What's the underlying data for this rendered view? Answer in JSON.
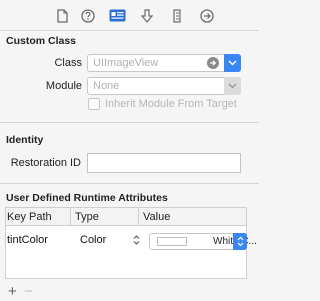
{
  "sections": {
    "custom_class": {
      "title": "Custom Class",
      "class_label": "Class",
      "class_value": "UIImageView",
      "module_label": "Module",
      "module_value": "None",
      "inherit_label": "Inherit Module From Target"
    },
    "identity": {
      "title": "Identity",
      "restoration_label": "Restoration ID",
      "restoration_value": ""
    },
    "runtime_attributes": {
      "title": "User Defined Runtime Attributes",
      "columns": [
        "Key Path",
        "Type",
        "Value"
      ],
      "rows": [
        {
          "key_path": "tintColor",
          "type": "Color",
          "value": "White C..."
        }
      ]
    }
  },
  "bottom_bar": {
    "add": "+",
    "remove": "−"
  },
  "colors": {
    "accent": "#3a86f3",
    "separator": "#d3d3d3"
  }
}
